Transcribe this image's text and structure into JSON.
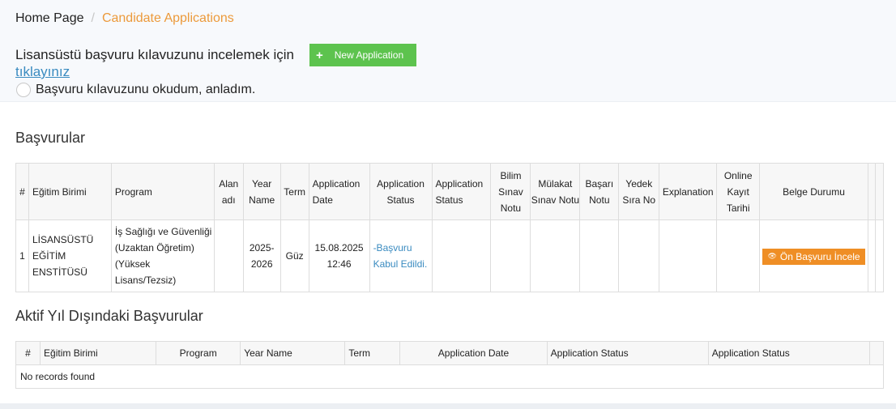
{
  "breadcrumb": {
    "home": "Home Page",
    "separator": "/",
    "current": "Candidate Applications"
  },
  "guide": {
    "text": "Lisansüstü başvuru kılavuzunu incelemek için",
    "link": "tıklayınız",
    "new_application_label": "New Application",
    "plus_icon": "+",
    "read_label": "Başvuru kılavuzunu okudum, anladım."
  },
  "applications": {
    "title": "Başvurular",
    "columns": [
      "#",
      "Eğitim Birimi",
      "Program",
      "Alan adı",
      "Year Name",
      "Term",
      "Application Date",
      "Application Status",
      "Application Status",
      "Bilim Sınav Notu",
      "Mülakat Sınav Notu",
      "Başarı Notu",
      "Yedek Sıra No",
      "Explanation",
      "Online Kayıt Tarihi",
      "Belge Durumu"
    ],
    "rows": [
      {
        "no": "1",
        "unit": "LİSANSÜSTÜ EĞİTİM ENSTİTÜSÜ",
        "program": "İş Sağlığı ve Güvenliği (Uzaktan Öğretim) (Yüksek Lisans/Tezsiz)",
        "field": "",
        "year": "2025-2026",
        "term": "Güz",
        "date": "15.08.2025 12:46",
        "status": "-Başvuru Kabul Edildi.",
        "status2": "",
        "science_score": "",
        "interview_score": "",
        "success_score": "",
        "reserve_no": "",
        "explanation": "",
        "online_reg_date": "",
        "review_label": "Ön Başvuru İncele",
        "review_icon": "eye-icon"
      }
    ]
  },
  "inactive": {
    "title": "Aktif Yıl Dışındaki Başvurular",
    "columns": [
      "#",
      "Eğitim Birimi",
      "Program",
      "Year Name",
      "Term",
      "Application Date",
      "Application Status",
      "Application Status"
    ],
    "empty": "No records found"
  }
}
